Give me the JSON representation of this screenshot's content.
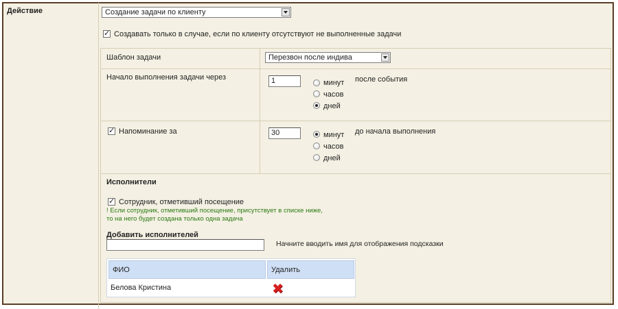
{
  "section_label": "Действие",
  "action_select": "Создание задачи по клиенту",
  "only_if_label": "Создавать только в случае, если по клиенту отсутствуют не выполненные задачи",
  "template": {
    "label": "Шаблон задачи",
    "value": "Перезвон после индива"
  },
  "start": {
    "label": "Начало выполнения задачи через",
    "value": "1",
    "units": [
      "минут",
      "часов",
      "дней"
    ],
    "selected": "дней",
    "suffix": "после события"
  },
  "reminder": {
    "label": "Напоминание за",
    "value": "30",
    "units": [
      "минут",
      "часов",
      "дней"
    ],
    "selected": "минут",
    "suffix": "до начала выполнения"
  },
  "executors": {
    "title": "Исполнители",
    "self_label": "Сотрудник, отметивший посещение",
    "note_line1": "! Если сотрудник, отметивший посещение, присутствует в списке ниже,",
    "note_line2": "то на него будет создана только одна задача",
    "add_title": "Добавить исполнителей",
    "add_hint": "Начните вводить имя для отображения подсказки",
    "table": {
      "col_name": "ФИО",
      "col_delete": "Удалить",
      "rows": [
        {
          "name": "Белова Кристина"
        }
      ]
    }
  },
  "icons": {
    "delete": "close-icon"
  },
  "colors": {
    "frame": "#5a3c24",
    "panel": "#f4f0e3",
    "header": "#cfdff5",
    "note": "#2a7a12",
    "delete": "#d62020"
  }
}
